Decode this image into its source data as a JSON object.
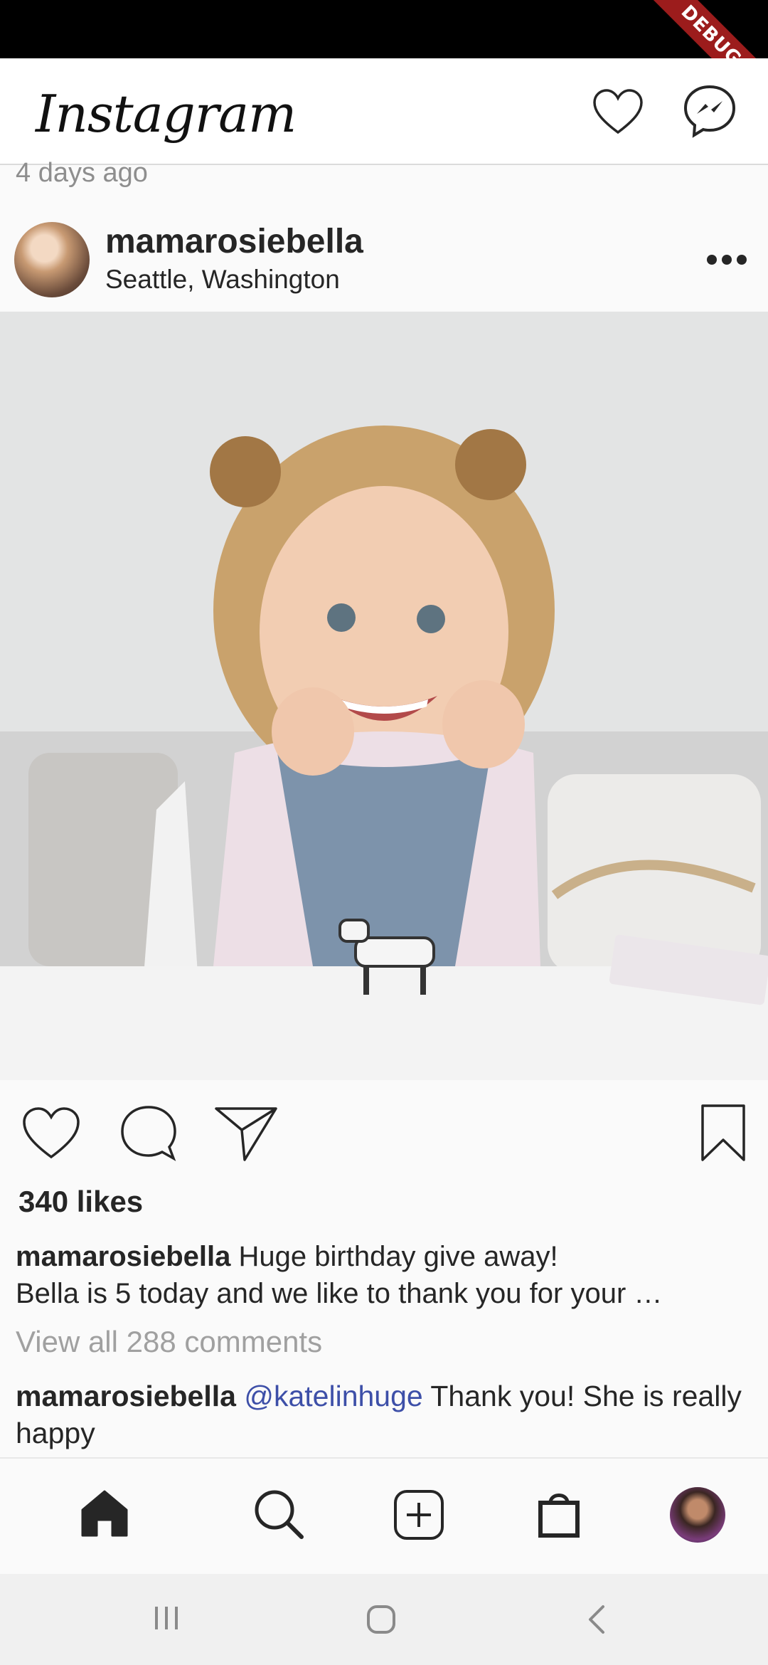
{
  "status_bar": {
    "debug_label": "DEBUG"
  },
  "app_bar": {
    "logo_text": "Instagram"
  },
  "feed": {
    "previous_post_time": "4 days ago"
  },
  "post": {
    "username": "mamarosiebella",
    "location": "Seattle, Washington",
    "likes": "340 likes",
    "caption_text": "Huge birthday give away!",
    "caption_line2": "Bella is 5 today and we like to thank you for your …",
    "view_comments": "View all 288 comments",
    "comment": {
      "username": "mamarosiebella",
      "mention": "@katelinhuge",
      "text": "Thank you! She is really happy"
    }
  },
  "bottom_nav": {
    "items": [
      "home-icon",
      "search-icon",
      "add-post-icon",
      "shopping-bag-icon",
      "profile-avatar"
    ]
  },
  "system_nav": {
    "items": [
      "recent-apps-icon",
      "home-circle-icon",
      "back-icon"
    ]
  },
  "colors": {
    "mention": "#3d4fa8",
    "debug_banner": "#9c1c1c",
    "text": "#262626",
    "muted": "#8e8e8e"
  }
}
